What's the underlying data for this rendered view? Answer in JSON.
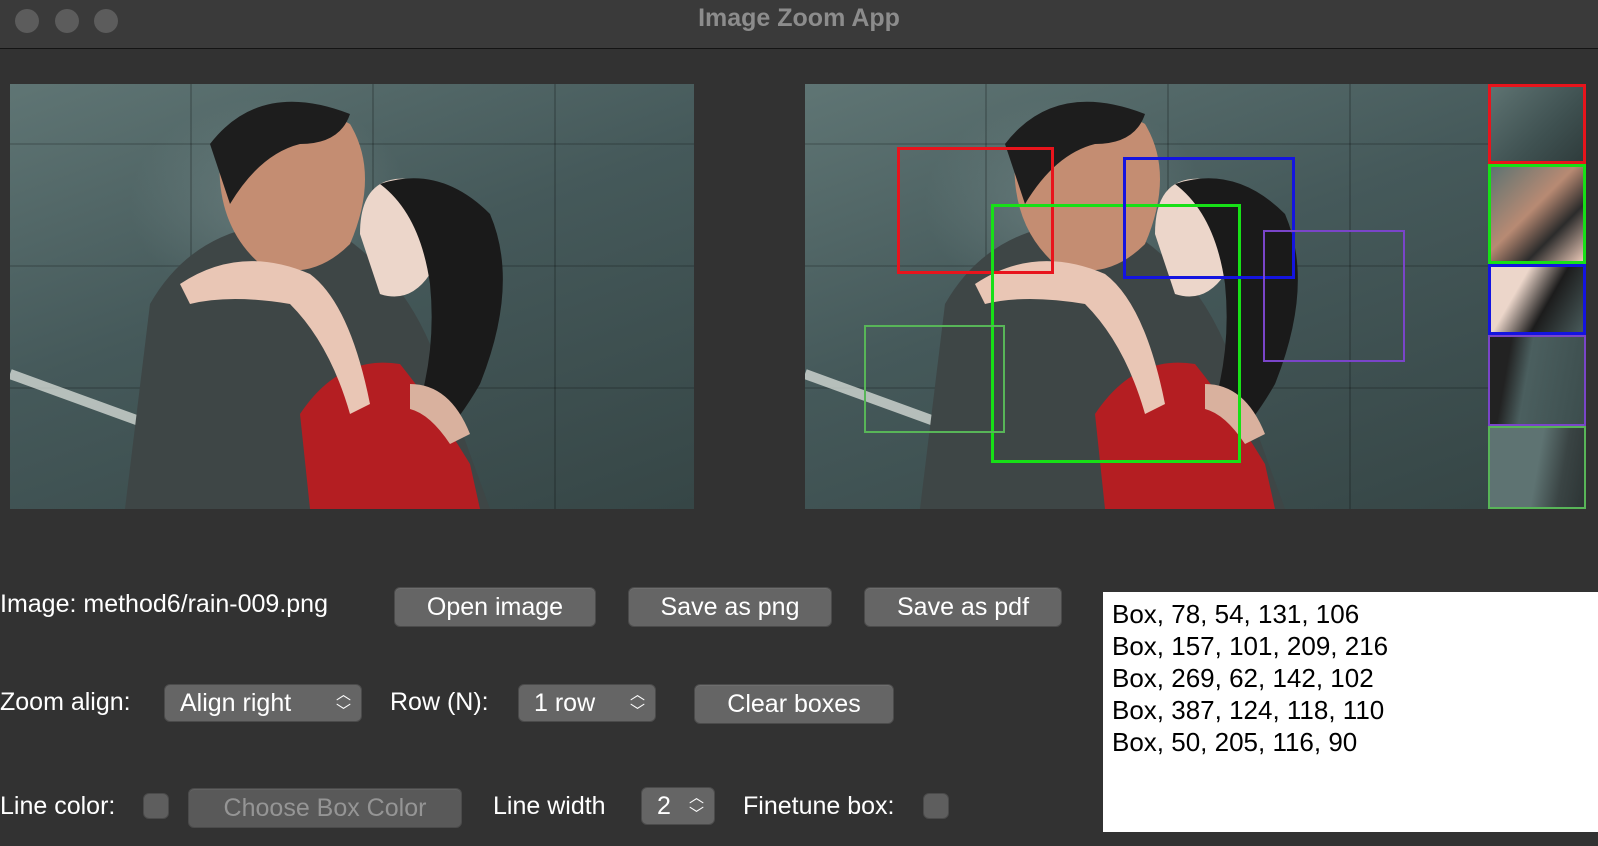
{
  "window": {
    "title": "Image Zoom App"
  },
  "controls": {
    "image_label": "Image: method6/rain-009.png",
    "open_image": "Open image",
    "save_png": "Save as png",
    "save_pdf": "Save as pdf",
    "zoom_align_label": "Zoom align:",
    "zoom_align_value": "Align right",
    "row_label": "Row (N):",
    "row_value": "1 row",
    "clear_boxes": "Clear boxes",
    "line_color_label": "Line color:",
    "choose_color": "Choose Box Color",
    "line_width_label": "Line width",
    "line_width_value": "2",
    "finetune_label": "Finetune box:"
  },
  "boxes": [
    {
      "text": "Box, 78, 54, 131, 106",
      "color": "#e8141c"
    },
    {
      "text": "Box, 157, 101, 209, 216",
      "color": "#17e017"
    },
    {
      "text": "Box, 269, 62, 142, 102",
      "color": "#1414e0"
    },
    {
      "text": "Box, 387, 124, 118, 110",
      "color": "#7a45c9"
    },
    {
      "text": "Box, 50, 205, 116, 90",
      "color": "#58b558"
    }
  ]
}
